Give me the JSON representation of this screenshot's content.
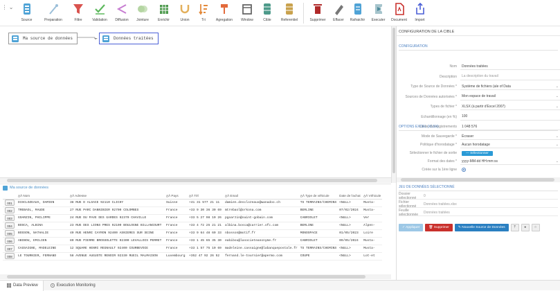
{
  "toolbar": {
    "buttons": [
      {
        "label": "Source",
        "icon": "database-icon",
        "color": "#4fa3d6"
      },
      {
        "label": "Preparation",
        "icon": "wand-icon",
        "color": "#9bbfd9"
      },
      {
        "label": "Filtre",
        "icon": "filter-icon",
        "color": "#d9534f"
      },
      {
        "label": "Validation",
        "icon": "check-icon",
        "color": "#5cb85c"
      },
      {
        "label": "Diffusion",
        "icon": "share-icon",
        "color": "#c77dd1"
      },
      {
        "label": "Jointure",
        "icon": "join-icon",
        "color": "#b5d5a3"
      },
      {
        "label": "Enrichir",
        "icon": "table-icon",
        "color": "#4d9a4d"
      },
      {
        "label": "Union",
        "icon": "union-icon",
        "color": "#e3b05c"
      },
      {
        "label": "Tri",
        "icon": "sort-icon",
        "color": "#e38a3c"
      },
      {
        "label": "Agregation",
        "icon": "aggregate-icon",
        "color": "#e36a3c"
      },
      {
        "label": "Window",
        "icon": "window-icon",
        "color": "#666666"
      },
      {
        "label": "Cible",
        "icon": "target-db-icon",
        "color": "#4d9a8a"
      },
      {
        "label": "Referentiel",
        "icon": "referential-icon",
        "color": "#c9a24d"
      },
      {
        "label": "Supprimer",
        "icon": "trash-icon",
        "color": "#b02a2a"
      },
      {
        "label": "Effacer",
        "icon": "eraser-icon",
        "color": "#777777"
      },
      {
        "label": "Rafraichir",
        "icon": "refresh-db-icon",
        "color": "#4fa3d6"
      },
      {
        "label": "Executer",
        "icon": "execute-icon",
        "color": "#4d8a9a"
      },
      {
        "label": "Document",
        "icon": "document-icon",
        "color": "#c9302c"
      },
      {
        "label": "Import",
        "icon": "import-icon",
        "color": "#4a5fd6"
      }
    ]
  },
  "canvas": {
    "source_node": "Ma source de données",
    "target_node": "Données traitées"
  },
  "grid": {
    "title": "Ma source de données",
    "columns": [
      "A̲Â Nom",
      "A̲Â Adresse",
      "A̲Â Pays",
      "A̲Â Tél",
      "A̲Â Email",
      "A̲Â Type de véhicule",
      "Date de l'achat",
      "A̲Â Véhicule"
    ],
    "rows": [
      {
        "idx": "001",
        "cells": [
          "DISCLOZEAUX, DAMIEN",
          "38 RUE D ALSACE 92110 CLICHY",
          "Suisse",
          "+41 31 577 21 11",
          "damien.desclozeaux@wanadoo.ch",
          "TS TERRAINS/CHEMINS",
          "<NULL>",
          "Musta-"
        ]
      },
      {
        "idx": "002",
        "cells": [
          "TREBAOL, MAUDE",
          "27 RUE PARC DANNIBIER 92700 COLOMBES",
          "France",
          "+33 9 30 36 30 69",
          "mtrebaol@orkona.com",
          "BERLINE",
          "07/02/2024",
          "Musta-"
        ]
      },
      {
        "idx": "003",
        "cells": [
          "GOARZIN, PHILIPPE",
          "24 RUE DU PAVE DES GARDES 92370 CHAVILLE",
          "France",
          "+33 5 27 98 10 26",
          "pgoarzin@saint-gobain.com",
          "CABRIOLET",
          "<NULL>",
          "Ver"
        ]
      },
      {
        "idx": "004",
        "cells": [
          "BOSCA, ALBINA",
          "23 RUE DES LIONS PRES 92100 BOULOGNE BILLANCOURT",
          "France",
          "+33 4 72 25 21 21",
          "albina.bosca@carrier.ofc.com",
          "BERLINE",
          "<NULL>",
          "Alpen-"
        ]
      },
      {
        "idx": "005",
        "cells": [
          "BOSSON, NATHALIE",
          "40 RUE HENRI CAYRON 92400 ASNIERES SUR SEINE",
          "France",
          "+33 9 64 48 60 33",
          "nbosson@motif.fr",
          "MONOSPACE",
          "01/05/2023",
          "Loire"
        ]
      },
      {
        "idx": "006",
        "cells": [
          "ABIBOU, EMILIEN",
          "80 RUE PIERRE BROSSOLETTE 92300 LEVALLOIS PERRET",
          "France",
          "+33 1 45 65 35 30",
          "eabibou@lasocieteanonyme.fr",
          "CABRIOLET",
          "09/05/2024",
          "Musta-"
        ]
      },
      {
        "idx": "007",
        "cells": [
          "CASSAIGNE, MADELEINE",
          "12 SQUARE HENRI REGNAULT 92400 COURBEVOIE",
          "France",
          "+33 1 57 75 10 69",
          "madeleine.cassaigne@labanquepostale.fr",
          "TS TERRAINS/CHEMINS",
          "<NULL>",
          "Musta-"
        ]
      },
      {
        "idx": "008",
        "cells": [
          "LE TOURNIER, FERNAND",
          "58 AVENUE AUGUSTE RENOIR 92330 RUEIL MALMAISON",
          "Luxembourg",
          "+352 47 92 26 52",
          "fernand.le-tournier@apermo.com",
          "COUPE",
          "<NULL>",
          "Lot-et"
        ]
      }
    ]
  },
  "bottom_tabs": {
    "data_preview": "Data Preview",
    "execution_monitoring": "Execution Monitoring"
  },
  "panel": {
    "title": "CONFIGURATION DE LA CIBLE",
    "section_config": "CONFIGURATION",
    "fields": [
      {
        "label": "Nom",
        "value": "Données traitées",
        "dropdown": false,
        "placeholder": false
      },
      {
        "label": "Description",
        "value": "La description du travail",
        "dropdown": false,
        "placeholder": true
      },
      {
        "label": "Type de Source de Données *",
        "value": "Système de fichiers (ale of Data",
        "dropdown": true,
        "placeholder": false
      },
      {
        "label": "Sources de Données autorisées *",
        "value": "Mon espace de travail",
        "dropdown": true,
        "placeholder": false
      },
      {
        "label": "Types de fichier *",
        "value": "XLSX (à partir d'Excel 2007)",
        "dropdown": true,
        "placeholder": false
      },
      {
        "label": "Echantillonnage (en %)",
        "value": "100",
        "dropdown": false,
        "placeholder": false
      },
      {
        "label": "Limite d'enregistrements",
        "value": "1 048 576",
        "dropdown": false,
        "placeholder": false
      }
    ],
    "section_excel": "OPTIONS EXCEL (XLSX)",
    "excel_fields": [
      {
        "label": "Mode de Sauvegarde *",
        "value": "Écraser",
        "type": "dropdown"
      },
      {
        "label": "Politique d'horodatage *",
        "value": "Aucun horodatage",
        "type": "dropdown"
      },
      {
        "label": "Sélectionner le fichier de sortie",
        "value": "— Sélectionner",
        "type": "button"
      },
      {
        "label": "Format des dates *",
        "value": "yyyy-MM-dd HH:mm:ss",
        "type": "dropdown"
      },
      {
        "label": "Créée sur la 1ère ligne",
        "value": "",
        "type": "check"
      }
    ],
    "dataset_section": "JEU DE DONNÉES SÉLECTIONNÉ",
    "dataset_rows": [
      {
        "label": "Dossier sélectionné",
        "value": "0"
      },
      {
        "label": "Fichier sélectionné",
        "value": "Données traitées.xlsx"
      },
      {
        "label": "Feuille sélectionnée",
        "value": "Données traitées"
      }
    ],
    "actions": {
      "apply": "✓ Appliquer",
      "delete": "🗑 Supprimer",
      "new_source": "✎ Nouvelle Source de Données"
    }
  }
}
